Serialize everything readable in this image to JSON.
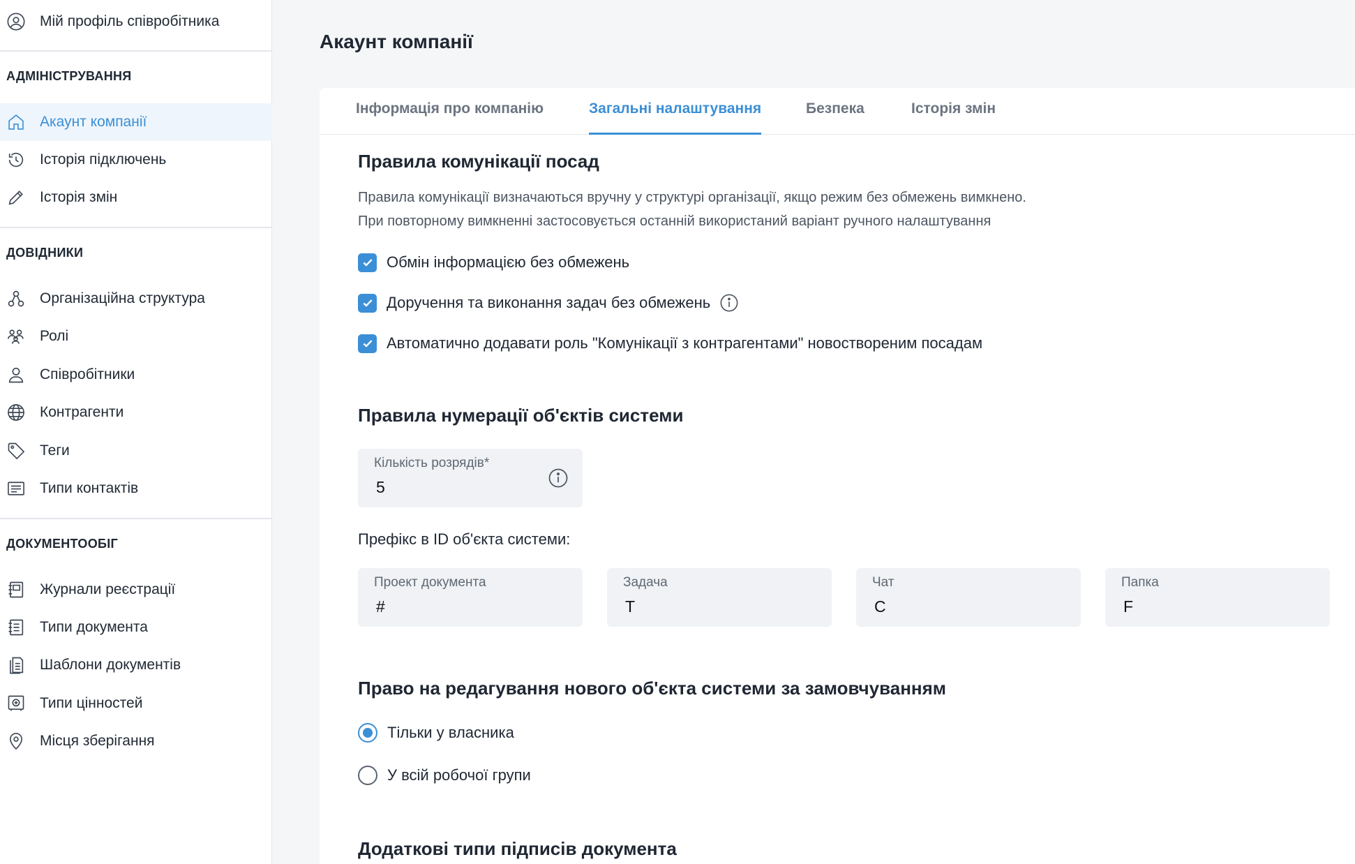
{
  "sidebar": {
    "profile": {
      "label": "Мій профіль співробітника",
      "icon": "user-circle-icon"
    },
    "sections": [
      {
        "heading": "АДМІНІСТРУВАННЯ",
        "items": [
          {
            "label": "Акаунт компанії",
            "icon": "home-icon",
            "active": true
          },
          {
            "label": "Історія підключень",
            "icon": "history-icon"
          },
          {
            "label": "Історія змін",
            "icon": "pencil-icon"
          }
        ]
      },
      {
        "heading": "ДОВІДНИКИ",
        "items": [
          {
            "label": "Організаційна структура",
            "icon": "org-structure-icon"
          },
          {
            "label": "Ролі",
            "icon": "roles-icon"
          },
          {
            "label": "Співробітники",
            "icon": "user-icon"
          },
          {
            "label": "Контрагенти",
            "icon": "globe-icon"
          },
          {
            "label": "Теги",
            "icon": "tag-icon"
          },
          {
            "label": "Типи контактів",
            "icon": "contact-card-icon"
          }
        ]
      },
      {
        "heading": "ДОКУМЕНТООБІГ",
        "items": [
          {
            "label": "Журнали реєстрації",
            "icon": "journal-icon"
          },
          {
            "label": "Типи документа",
            "icon": "document-icon"
          },
          {
            "label": "Шаблони документів",
            "icon": "templates-icon"
          },
          {
            "label": "Типи цінностей",
            "icon": "safe-icon"
          },
          {
            "label": "Місця зберігання",
            "icon": "location-pin-icon"
          }
        ]
      }
    ]
  },
  "main": {
    "title": "Акаунт компанії",
    "tabs": [
      {
        "label": "Інформація про компанію"
      },
      {
        "label": "Загальні налаштування",
        "active": true
      },
      {
        "label": "Безпека"
      },
      {
        "label": "Історія змін"
      }
    ],
    "communication": {
      "title": "Правила комунікації посад",
      "desc1": "Правила комунікації визначаються вручну у структурі організації, якщо режим без обмежень вимкнено.",
      "desc2": "При повторному вимкненні застосовується останній використаний варіант ручного налаштування",
      "options": [
        {
          "label": "Обмін інформацією без обмежень",
          "checked": true
        },
        {
          "label": "Доручення та виконання задач без обмежень",
          "checked": true
        },
        {
          "label": "Автоматично додавати роль \"Комунікації з контрагентами\" новоствореним посадам",
          "checked": true
        }
      ]
    },
    "numbering": {
      "title": "Правила нумерації об'єктів системи",
      "digits": {
        "label": "Кількість розрядів*",
        "value": "5"
      },
      "prefix_label": "Префікс в ID об'єкта системи:",
      "prefixes": [
        {
          "label": "Проект документа",
          "value": "#"
        },
        {
          "label": "Задача",
          "value": "T"
        },
        {
          "label": "Чат",
          "value": "C"
        },
        {
          "label": "Папка",
          "value": "F"
        }
      ]
    },
    "edit_rights": {
      "title": "Право на редагування нового об'єкта системи за замовчуванням",
      "options": [
        {
          "label": "Тільки у власника",
          "selected": true
        },
        {
          "label": "У всій робочої групи",
          "selected": false
        }
      ]
    },
    "signatures": {
      "title": "Додаткові типи підписів документа"
    }
  },
  "colors": {
    "accent": "#3b8fd6",
    "active_bg": "#eef5fc",
    "field_bg": "#f0f2f5"
  }
}
